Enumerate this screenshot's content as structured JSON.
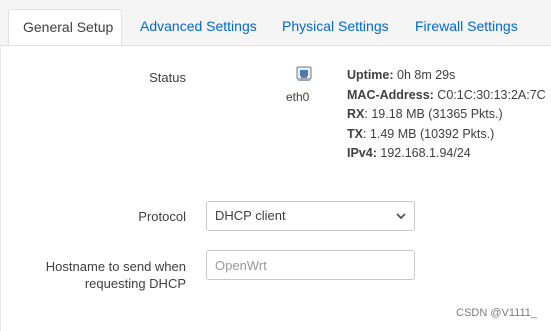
{
  "tabs": [
    {
      "label": "General Setup",
      "active": true
    },
    {
      "label": "Advanced Settings",
      "active": false
    },
    {
      "label": "Physical Settings",
      "active": false
    },
    {
      "label": "Firewall Settings",
      "active": false
    }
  ],
  "status": {
    "label": "Status",
    "interface": {
      "name": "eth0",
      "icon": "ethernet-port-icon"
    },
    "info": [
      {
        "key": "Uptime:",
        "value": " 0h 8m 29s"
      },
      {
        "key": "MAC-Address:",
        "value": " C0:1C:30:13:2A:7C"
      },
      {
        "key": "RX",
        "value": ": 19.18 MB (31365 Pkts.)"
      },
      {
        "key": "TX",
        "value": ": 1.49 MB (10392 Pkts.)"
      },
      {
        "key": "IPv4:",
        "value": " 192.168.1.94/24"
      }
    ]
  },
  "protocol": {
    "label": "Protocol",
    "selected": "DHCP client"
  },
  "hostname": {
    "label": "Hostname to send when requesting DHCP",
    "placeholder": "OpenWrt"
  },
  "watermark": "CSDN @V1111_",
  "colors": {
    "link": "#0069d6",
    "text": "#404040",
    "tab_bg": "#f5f5f5",
    "border": "#c8c8c8"
  }
}
